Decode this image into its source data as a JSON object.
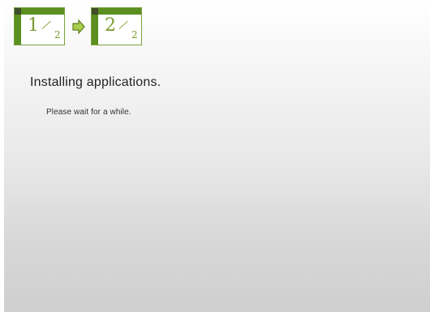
{
  "progress": {
    "steps": [
      {
        "numerator": "1",
        "denominator": "2"
      },
      {
        "numerator": "2",
        "denominator": "2"
      }
    ],
    "arrow_icon": "right-arrow-icon",
    "accent_color": "#5b8f1f"
  },
  "content": {
    "heading": "Installing applications.",
    "message": "Please wait for a while."
  }
}
